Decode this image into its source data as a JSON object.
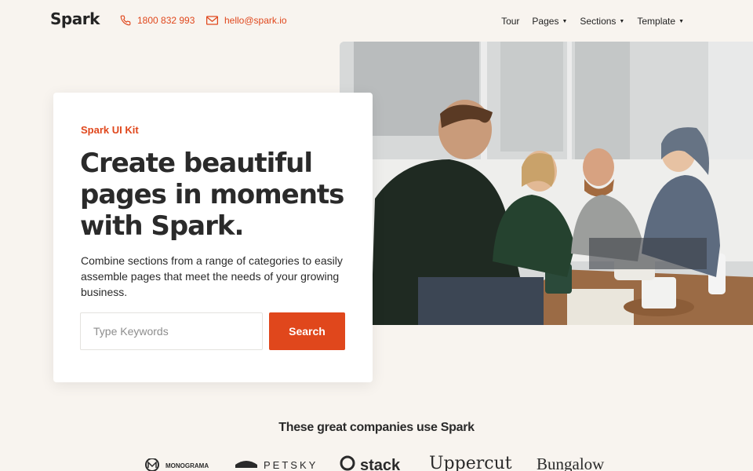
{
  "header": {
    "logo": "Spark",
    "phone": "1800 832 993",
    "email": "hello@spark.io",
    "nav": [
      {
        "label": "Tour",
        "dropdown": false
      },
      {
        "label": "Pages",
        "dropdown": true
      },
      {
        "label": "Sections",
        "dropdown": true
      },
      {
        "label": "Template",
        "dropdown": true
      }
    ]
  },
  "hero": {
    "eyebrow": "Spark UI Kit",
    "headline": "Create beautiful pages in moments with Spark.",
    "lede": "Combine sections from a range of categories to easily assemble pages that meet the needs of your growing business.",
    "search": {
      "placeholder": "Type Keywords",
      "value": "",
      "button_label": "Search"
    }
  },
  "companies": {
    "title": "These great companies use Spark",
    "logos": [
      "MONOGRAMA",
      "PETSKY",
      "stack",
      "Uppercut",
      "Bungalow"
    ]
  },
  "colors": {
    "accent": "#e0471c",
    "background": "#f8f4ef",
    "text": "#242424"
  },
  "icons": {
    "phone": "phone-icon",
    "email": "mail-icon",
    "caret": "caret-down-icon"
  }
}
